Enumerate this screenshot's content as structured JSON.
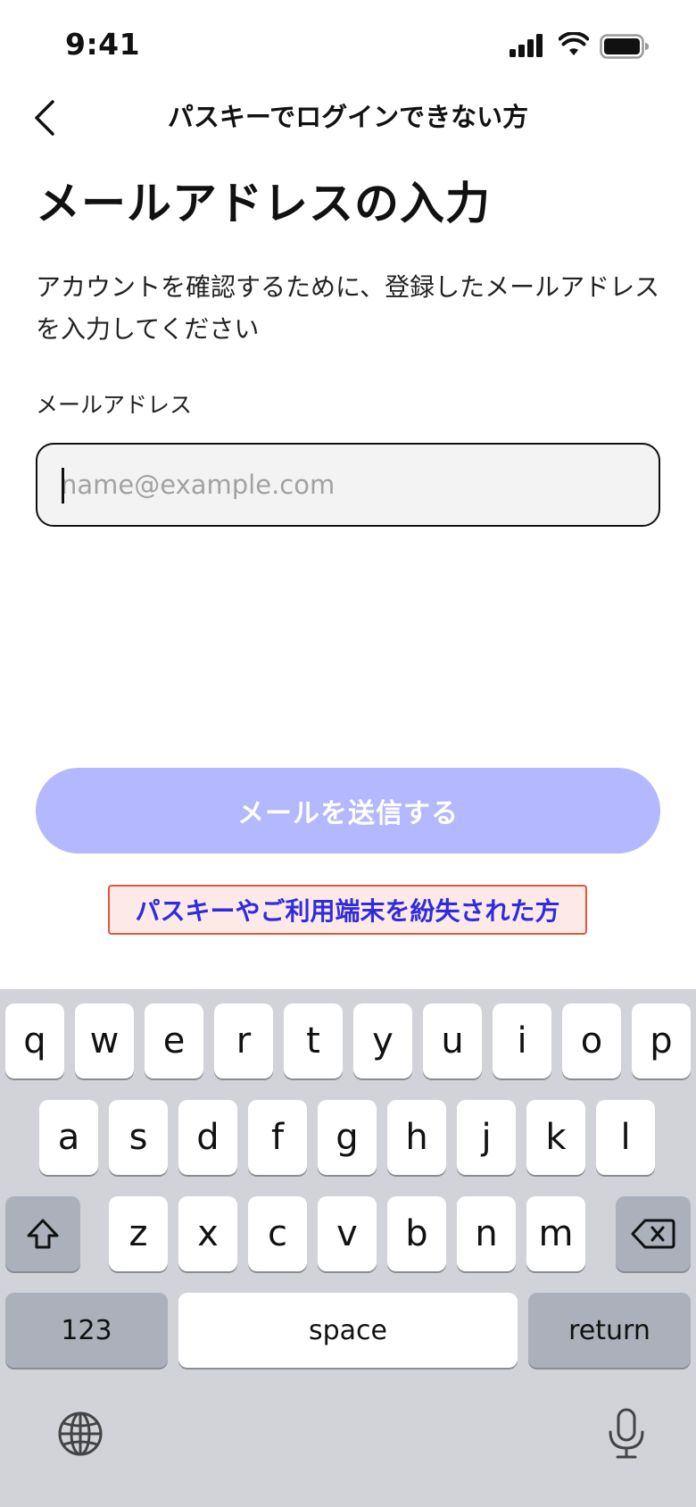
{
  "status_bar": {
    "time": "9:41"
  },
  "nav": {
    "title": "パスキーでログインできない方"
  },
  "page": {
    "title": "メールアドレスの入力",
    "description": "アカウントを確認するために、登録したメールアドレスを入力してください",
    "field_label": "メールアドレス",
    "email_placeholder": "name@example.com",
    "email_value": "",
    "send_button": "メールを送信する",
    "lost_device_link": "パスキーやご利用端末を紛失された方"
  },
  "colors": {
    "send_button_bg": "#b3b8ff",
    "link_text": "#2f2be0",
    "highlight_border": "#e0573e",
    "highlight_bg": "#fde9e6",
    "keyboard_bg": "#d1d3d9"
  },
  "keyboard": {
    "row1": [
      "q",
      "w",
      "e",
      "r",
      "t",
      "y",
      "u",
      "i",
      "o",
      "p"
    ],
    "row2": [
      "a",
      "s",
      "d",
      "f",
      "g",
      "h",
      "j",
      "k",
      "l"
    ],
    "row3": [
      "z",
      "x",
      "c",
      "v",
      "b",
      "n",
      "m"
    ],
    "numbers_key": "123",
    "space_key": "space",
    "return_key": "return",
    "icons": [
      "shift-icon",
      "delete-icon",
      "globe-icon",
      "microphone-icon"
    ]
  }
}
